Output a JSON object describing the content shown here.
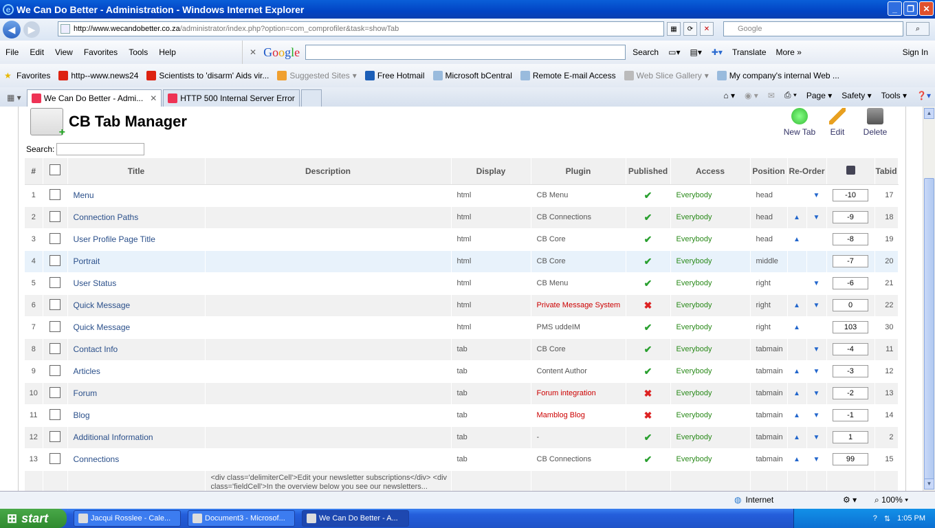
{
  "window": {
    "title": "We Can Do Better - Administration - Windows Internet Explorer"
  },
  "address": {
    "domain": "http://www.wecandobetter.co.za",
    "path": "/administrator/index.php?option=com_comprofiler&task=showTab",
    "search_placeholder": "Google"
  },
  "menu": [
    "File",
    "Edit",
    "View",
    "Favorites",
    "Tools",
    "Help"
  ],
  "google_bar": {
    "logo": "Google",
    "search": "Search",
    "translate": "Translate",
    "more": "More »",
    "signin": "Sign In"
  },
  "favorites": {
    "label": "Favorites",
    "items": [
      "http--www.news24",
      "Scientists to 'disarm' Aids vir...",
      "Suggested Sites",
      "Free Hotmail",
      "Microsoft bCentral",
      "Remote E-mail Access",
      "Web Slice Gallery",
      "My company's internal Web ..."
    ]
  },
  "tabs": [
    {
      "label": "We Can Do Better - Admi..."
    },
    {
      "label": "HTTP 500 Internal Server Error"
    }
  ],
  "commands": {
    "page": "Page",
    "safety": "Safety",
    "tools": "Tools"
  },
  "page": {
    "title": "CB Tab Manager",
    "search_label": "Search:",
    "toolbar": {
      "new": "New Tab",
      "edit": "Edit",
      "delete": "Delete"
    },
    "columns": [
      "#",
      "Title",
      "Description",
      "Display",
      "Plugin",
      "Published",
      "Access",
      "Position",
      "Re-Order",
      "Tabid"
    ],
    "rows": [
      {
        "n": "1",
        "title": "Menu",
        "display": "html",
        "plugin": "CB Menu",
        "published": true,
        "access": "Everybody",
        "position": "head",
        "up": false,
        "down": true,
        "order": "-10",
        "tabid": "17"
      },
      {
        "n": "2",
        "title": "Connection Paths",
        "display": "html",
        "plugin": "CB Connections",
        "published": true,
        "access": "Everybody",
        "position": "head",
        "up": true,
        "down": true,
        "order": "-9",
        "tabid": "18"
      },
      {
        "n": "3",
        "title": "User Profile Page Title",
        "display": "html",
        "plugin": "CB Core",
        "published": true,
        "access": "Everybody",
        "position": "head",
        "up": true,
        "down": false,
        "order": "-8",
        "tabid": "19"
      },
      {
        "n": "4",
        "title": "Portrait",
        "display": "html",
        "plugin": "CB Core",
        "published": true,
        "access": "Everybody",
        "position": "middle",
        "up": false,
        "down": false,
        "order": "-7",
        "tabid": "20"
      },
      {
        "n": "5",
        "title": "User Status",
        "display": "html",
        "plugin": "CB Menu",
        "published": true,
        "access": "Everybody",
        "position": "right",
        "up": false,
        "down": true,
        "order": "-6",
        "tabid": "21"
      },
      {
        "n": "6",
        "title": "Quick Message",
        "display": "html",
        "plugin": "Private Message System",
        "plugin_red": true,
        "published": false,
        "access": "Everybody",
        "position": "right",
        "up": true,
        "down": true,
        "order": "0",
        "tabid": "22"
      },
      {
        "n": "7",
        "title": "Quick Message",
        "display": "html",
        "plugin": "PMS uddeIM",
        "published": true,
        "access": "Everybody",
        "position": "right",
        "up": true,
        "down": false,
        "order": "103",
        "tabid": "30"
      },
      {
        "n": "8",
        "title": "Contact Info",
        "display": "tab",
        "plugin": "CB Core",
        "published": true,
        "access": "Everybody",
        "position": "tabmain",
        "up": false,
        "down": true,
        "order": "-4",
        "tabid": "11"
      },
      {
        "n": "9",
        "title": "Articles",
        "display": "tab",
        "plugin": "Content Author",
        "published": true,
        "access": "Everybody",
        "position": "tabmain",
        "up": true,
        "down": true,
        "order": "-3",
        "tabid": "12"
      },
      {
        "n": "10",
        "title": "Forum",
        "display": "tab",
        "plugin": "Forum integration",
        "plugin_red": true,
        "published": false,
        "access": "Everybody",
        "position": "tabmain",
        "up": true,
        "down": true,
        "order": "-2",
        "tabid": "13"
      },
      {
        "n": "11",
        "title": "Blog",
        "display": "tab",
        "plugin": "Mamblog Blog",
        "plugin_red": true,
        "published": false,
        "access": "Everybody",
        "position": "tabmain",
        "up": true,
        "down": true,
        "order": "-1",
        "tabid": "14"
      },
      {
        "n": "12",
        "title": "Additional Information",
        "display": "tab",
        "plugin": "-",
        "published": true,
        "access": "Everybody",
        "position": "tabmain",
        "up": true,
        "down": true,
        "order": "1",
        "tabid": "2"
      },
      {
        "n": "13",
        "title": "Connections",
        "display": "tab",
        "plugin": "CB Connections",
        "published": true,
        "access": "Everybody",
        "position": "tabmain",
        "up": true,
        "down": true,
        "order": "99",
        "tabid": "15"
      }
    ],
    "last_row_description": "<div class='delimiterCell'>Edit your newsletter subscriptions</div> <div class='fieldCell'>In the overview below you see our newsletters..."
  },
  "status": {
    "zone": "Internet",
    "zoom": "100%"
  },
  "taskbar": {
    "start": "start",
    "tasks": [
      "Jacqui Rosslee - Cale...",
      "Document3 - Microsof...",
      "We Can Do Better - A..."
    ],
    "clock": "1:05 PM"
  }
}
